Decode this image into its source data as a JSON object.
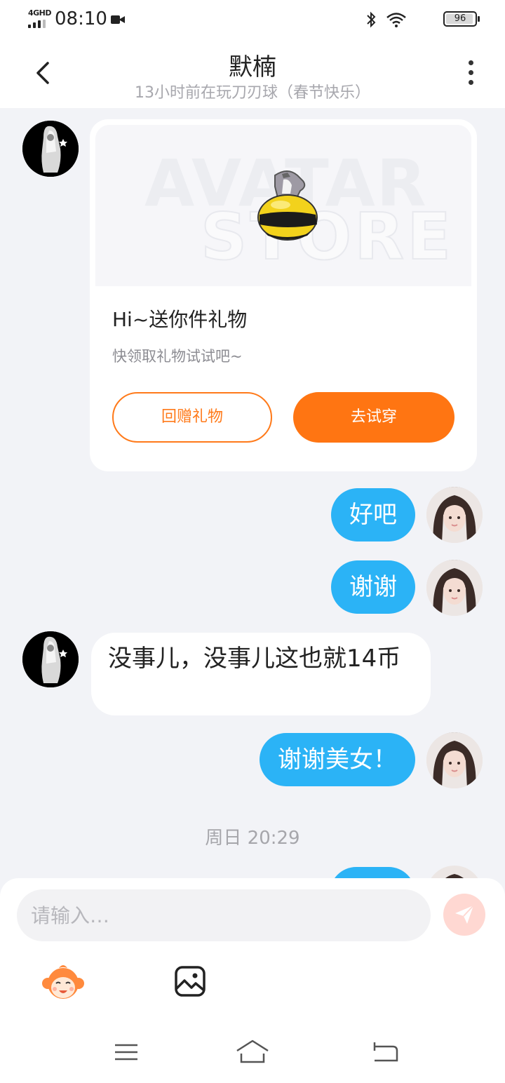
{
  "status_bar": {
    "network": "4GHD",
    "time": "08:10",
    "battery": 96
  },
  "header": {
    "title": "默楠",
    "subtitle": "13小时前在玩刀刃球（春节快乐）"
  },
  "gift_card": {
    "banner_watermark_1": "AVATAR",
    "banner_watermark_2": "STORE",
    "title": "Hi~送你件礼物",
    "description": "快领取礼物试试吧~",
    "return_gift_label": "回赠礼物",
    "try_on_label": "去试穿",
    "accent_color": "#ff7512"
  },
  "messages": [
    {
      "sender": "me",
      "text": "好吧"
    },
    {
      "sender": "me",
      "text": "谢谢"
    },
    {
      "sender": "other",
      "text": "没事儿，没事儿这也就14币"
    },
    {
      "sender": "me",
      "text": "谢谢美女！"
    }
  ],
  "time_divider": "周日 20:29",
  "input": {
    "placeholder": "请输入…"
  },
  "icons": {
    "back": "chevron-left-icon",
    "more": "more-vertical-icon",
    "send": "paper-plane-icon",
    "sticker": "monkey-sticker-icon",
    "image": "image-icon"
  },
  "colors": {
    "my_bubble": "#2bb3f6",
    "other_bubble": "#ffffff",
    "background": "#f2f3f7"
  }
}
